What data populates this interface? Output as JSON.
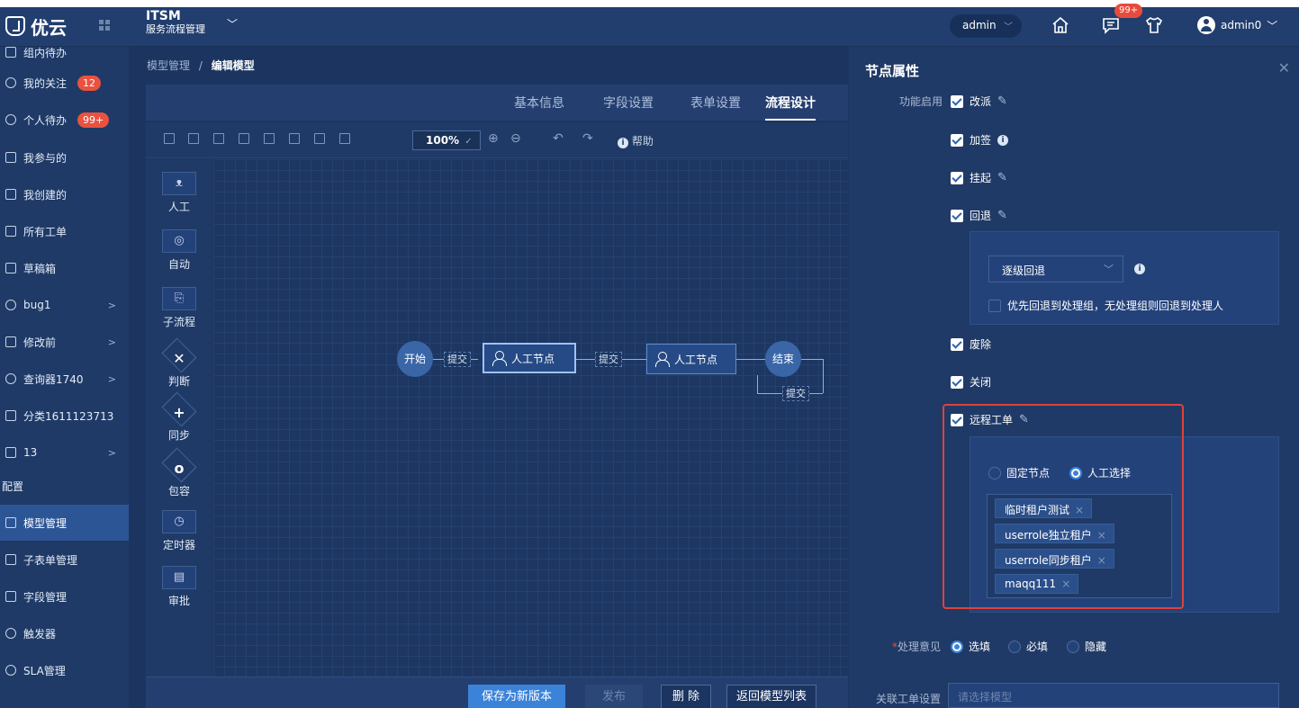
{
  "header": {
    "logo_text": "优云",
    "system_title": "ITSM",
    "system_subtitle": "服务流程管理",
    "admin_select": "admin",
    "notify_badge": "99+",
    "user_name": "admin0"
  },
  "sidebar": {
    "items": [
      {
        "label": "组内待办",
        "icon": "group-icon"
      },
      {
        "label": "我的关注",
        "badge": "12"
      },
      {
        "label": "个人待办",
        "badge": "99+"
      },
      {
        "label": "我参与的"
      },
      {
        "label": "我创建的"
      },
      {
        "label": "所有工单"
      },
      {
        "label": "草稿箱"
      },
      {
        "label": "bug1"
      },
      {
        "label": "修改前"
      },
      {
        "label": "查询器1740"
      },
      {
        "label": "分类1611123713"
      },
      {
        "label": "13"
      },
      {
        "label": "配置"
      },
      {
        "label": "模型管理"
      },
      {
        "label": "子表单管理"
      },
      {
        "label": "字段管理"
      },
      {
        "label": "触发器"
      },
      {
        "label": "SLA管理"
      }
    ]
  },
  "main": {
    "breadcrumb_root": "模型管理",
    "breadcrumb_sep": "/",
    "breadcrumb_current": "编辑模型",
    "tabs": [
      "基本信息",
      "字段设置",
      "表单设置",
      "流程设计"
    ],
    "zoom": "100%",
    "help": "帮助",
    "palette": [
      "人工",
      "自动",
      "子流程",
      "判断",
      "同步",
      "包容",
      "定时器",
      "审批"
    ],
    "flow": {
      "start": "开始",
      "end": "结束",
      "node1": "人工节点",
      "node2": "人工节点",
      "edge1": "提交",
      "edge2": "提交",
      "edge3": "提交"
    },
    "buttons": {
      "save_new": "保存为新版本",
      "publish": "发布",
      "delete": "删 除",
      "back": "返回模型列表"
    }
  },
  "panel": {
    "title": "节点属性",
    "feature_label": "功能启用",
    "checks": [
      "改派",
      "加签",
      "挂起",
      "回退",
      "废除",
      "关闭",
      "远程工单"
    ],
    "rollback_select": "逐级回退",
    "rollback_option": "优先回退到处理组，无处理组则回退到处理人",
    "remote_radio_fixed": "固定节点",
    "remote_radio_manual": "人工选择",
    "tenants": [
      "临时租户测试",
      "userrole独立租户",
      "userrole同步租户",
      "maqq111"
    ],
    "opinion_label": "处理意见",
    "opinion_options": [
      "选填",
      "必填",
      "隐藏"
    ],
    "related_label": "关联工单设置",
    "related_placeholder": "请选择模型"
  },
  "colors": {
    "accent": "#3b83d9",
    "highlight_frame": "#e0413a",
    "badge": "#e8523f"
  }
}
